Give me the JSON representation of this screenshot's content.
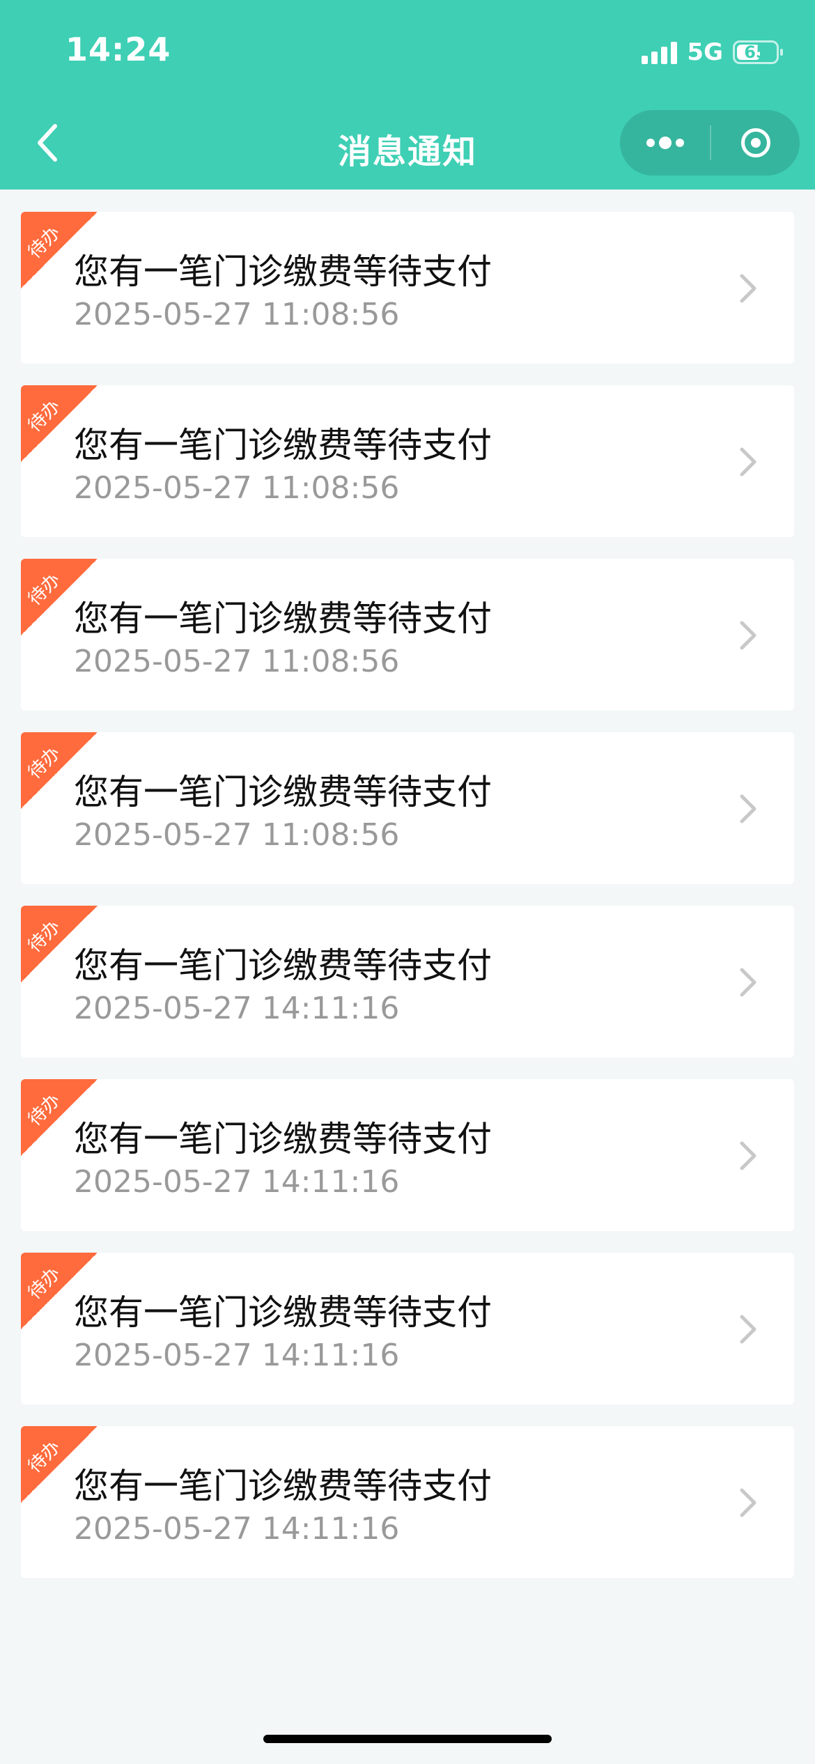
{
  "status_bar": {
    "time": "14:24",
    "network": "5G",
    "battery": "65",
    "battery_level": 0.65
  },
  "header": {
    "title": "消息通知",
    "back_icon": "chevron-left-icon",
    "more_icon": "more-dots-icon",
    "close_icon": "target-close-icon"
  },
  "colors": {
    "header_bg": "#3ecfb4",
    "page_bg": "#f3f7f8",
    "tag_bg": "#ff6b3d",
    "title_text": "#111111",
    "time_text": "#999999",
    "chevron": "#c8c8c8"
  },
  "notifications": [
    {
      "tag": "待办",
      "title": "您有一笔门诊缴费等待支付",
      "time": "2025-05-27 11:08:56"
    },
    {
      "tag": "待办",
      "title": "您有一笔门诊缴费等待支付",
      "time": "2025-05-27 11:08:56"
    },
    {
      "tag": "待办",
      "title": "您有一笔门诊缴费等待支付",
      "time": "2025-05-27 11:08:56"
    },
    {
      "tag": "待办",
      "title": "您有一笔门诊缴费等待支付",
      "time": "2025-05-27 11:08:56"
    },
    {
      "tag": "待办",
      "title": "您有一笔门诊缴费等待支付",
      "time": "2025-05-27 14:11:16"
    },
    {
      "tag": "待办",
      "title": "您有一笔门诊缴费等待支付",
      "time": "2025-05-27 14:11:16"
    },
    {
      "tag": "待办",
      "title": "您有一笔门诊缴费等待支付",
      "time": "2025-05-27 14:11:16"
    },
    {
      "tag": "待办",
      "title": "您有一笔门诊缴费等待支付",
      "time": "2025-05-27 14:11:16"
    }
  ]
}
